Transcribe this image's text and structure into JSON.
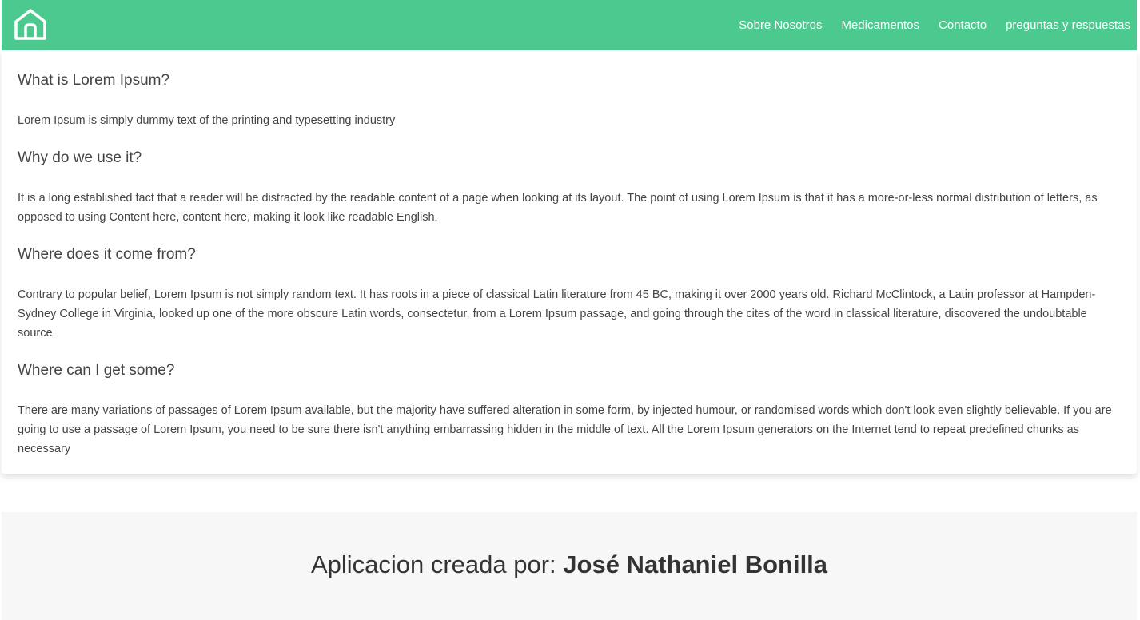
{
  "nav": {
    "home_icon": "home-icon",
    "links": [
      "Sobre Nosotros",
      "Medicamentos",
      "Contacto",
      "preguntas y respuestas"
    ]
  },
  "sections": [
    {
      "title": "What is Lorem Ipsum?",
      "text": "Lorem Ipsum is simply dummy text of the printing and typesetting industry"
    },
    {
      "title": "Why do we use it?",
      "text": "It is a long established fact that a reader will be distracted by the readable content of a page when looking at its layout. The point of using Lorem Ipsum is that it has a more-or-less normal distribution of letters, as opposed to using Content here, content here, making it look like readable English."
    },
    {
      "title": "Where does it come from?",
      "text": "Contrary to popular belief, Lorem Ipsum is not simply random text. It has roots in a piece of classical Latin literature from 45 BC, making it over 2000 years old. Richard McClintock, a Latin professor at Hampden-Sydney College in Virginia, looked up one of the more obscure Latin words, consectetur, from a Lorem Ipsum passage, and going through the cites of the word in classical literature, discovered the undoubtable source."
    },
    {
      "title": "Where can I get some?",
      "text": "There are many variations of passages of Lorem Ipsum available, but the majority have suffered alteration in some form, by injected humour, or randomised words which don't look even slightly believable. If you are going to use a passage of Lorem Ipsum, you need to be sure there isn't anything embarrassing hidden in the middle of text. All the Lorem Ipsum generators on the Internet tend to repeat predefined chunks as necessary"
    }
  ],
  "footer": {
    "prefix": "Aplicacion creada por: ",
    "author": "José Nathaniel Bonilla"
  },
  "colors": {
    "navbar": "#4cc98e",
    "footer_bg": "#f7f7f7",
    "text": "#444444"
  }
}
